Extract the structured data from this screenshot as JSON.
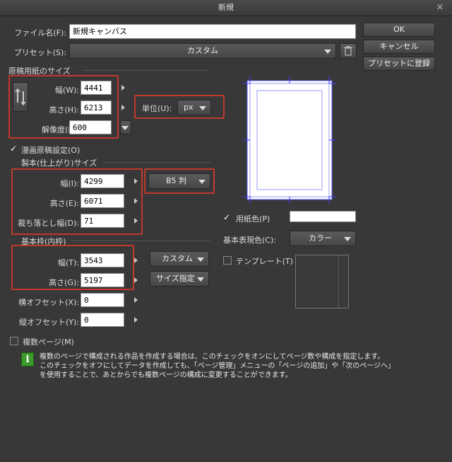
{
  "window": {
    "title": "新規",
    "close_glyph": "×"
  },
  "file_name": {
    "label": "ファイル名(F):",
    "value": "新規キャンバス"
  },
  "preset": {
    "label": "プリセット(S):",
    "value": "カスタム",
    "trash_icon": "trash-icon"
  },
  "buttons": {
    "ok": "OK",
    "cancel": "キャンセル",
    "register_preset": "プリセットに登録"
  },
  "manuscript": {
    "section_label": "原稿用紙のサイズ",
    "width_label": "幅(W):",
    "width_value": "4441",
    "height_label": "高さ(H):",
    "height_value": "6213",
    "resolution_label": "解像度(R):",
    "resolution_value": "600",
    "unit_label": "単位(U):",
    "unit_value": "px",
    "rotate_icon": "rotate-orientation-icon"
  },
  "manga_setting": {
    "label": "漫画原稿設定(O)",
    "checked": true
  },
  "binding": {
    "section_label": "製本(仕上がり)サイズ",
    "width_label": "幅(I):",
    "width_value": "4299",
    "height_label": "高さ(E):",
    "height_value": "6071",
    "bleed_label": "裁ち落とし幅(D):",
    "bleed_value": "71",
    "size_preset": "B5 判"
  },
  "base_frame": {
    "section_label": "基本枠(内枠)",
    "width_label": "幅(T):",
    "width_value": "3543",
    "height_label": "高さ(G):",
    "height_value": "5197",
    "preset": "カスタム",
    "size_mode": "サイズ指定",
    "xoffset_label": "横オフセット(X):",
    "xoffset_value": "0",
    "yoffset_label": "縦オフセット(Y):",
    "yoffset_value": "0"
  },
  "paper_color": {
    "label": "用紙色(P)",
    "checked": true,
    "color": "#ffffff"
  },
  "display_color": {
    "label": "基本表現色(C):",
    "value": "カラー"
  },
  "template": {
    "label": "テンプレート(T)",
    "checked": false
  },
  "multi_page": {
    "label": "複数ページ(M)",
    "checked": false
  },
  "info": {
    "icon": "info-icon",
    "line1": "複数のページで構成される作品を作成する場合は、このチェックをオンにしてページ数や構成を指定します。",
    "line2": "このチェックをオフにしてデータを作成しても、「ページ管理」メニューの「ページの追加」や「次のページへ」",
    "line3": "を使用することで、あとからでも複数ページの構成に変更することができます。"
  },
  "colors": {
    "highlight_border": "#c0392b",
    "preview_guides": "#3a3aff",
    "info_icon_bg": "#3a9a2a"
  }
}
